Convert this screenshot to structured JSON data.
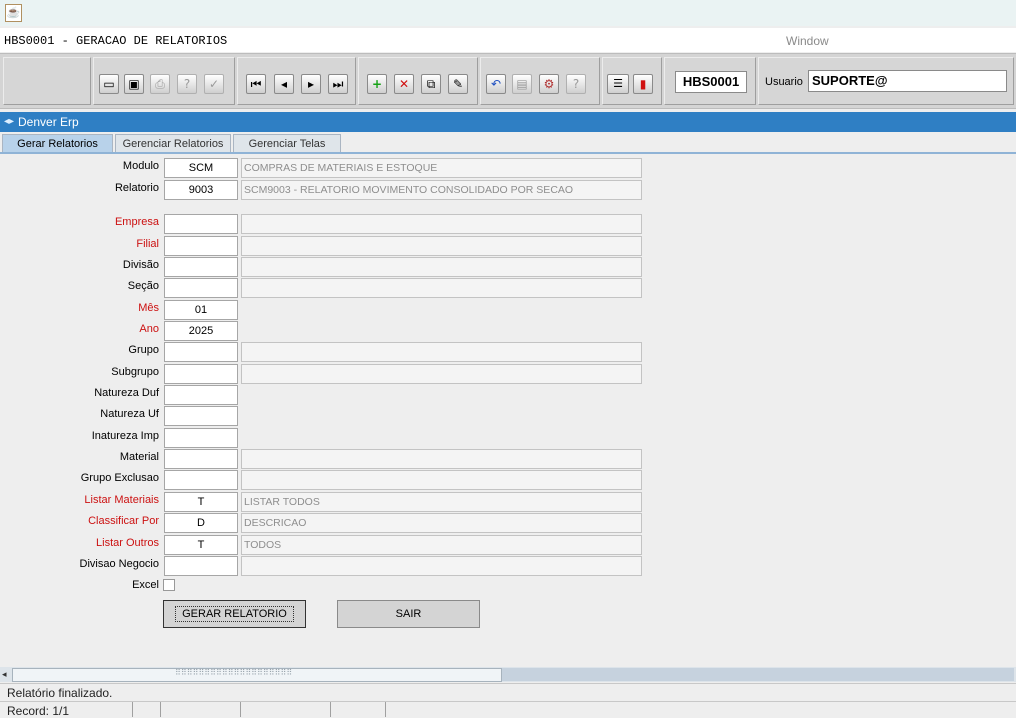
{
  "window": {
    "title": "HBS0001 - GERACAO DE RELATORIOS",
    "menu": "Window"
  },
  "toolbar": {
    "form_code": "HBS0001",
    "user_label": "Usuario",
    "user_value": "SUPORTE@",
    "buttons": [
      {
        "icon": "save-icon",
        "glyph": "▭"
      },
      {
        "icon": "window-icon",
        "glyph": "▣"
      },
      {
        "icon": "print-icon",
        "glyph": "⎙"
      },
      {
        "icon": "query-help-icon",
        "glyph": "?"
      },
      {
        "icon": "execute-query-icon",
        "glyph": "✓"
      },
      {
        "icon": "first-record-icon",
        "glyph": "⏮"
      },
      {
        "icon": "previous-record-icon",
        "glyph": "◂"
      },
      {
        "icon": "next-record-icon",
        "glyph": "▸"
      },
      {
        "icon": "last-record-icon",
        "glyph": "⏭"
      },
      {
        "icon": "insert-record-icon",
        "glyph": "+"
      },
      {
        "icon": "delete-record-icon",
        "glyph": "✕"
      },
      {
        "icon": "duplicate-record-icon",
        "glyph": "⧉"
      },
      {
        "icon": "edit-icon",
        "glyph": "✎"
      },
      {
        "icon": "undo-icon",
        "glyph": "↶"
      },
      {
        "icon": "clipboard-icon",
        "glyph": "📋"
      },
      {
        "icon": "tools-icon",
        "glyph": "⚙"
      },
      {
        "icon": "help-icon",
        "glyph": "?"
      },
      {
        "icon": "menu-icon",
        "glyph": "☰"
      },
      {
        "icon": "exit-door-icon",
        "glyph": "▮"
      }
    ]
  },
  "app": {
    "title": "Denver Erp",
    "tabs": [
      "Gerar Relatorios",
      "Gerenciar Relatorios",
      "Gerenciar Telas"
    ]
  },
  "form": {
    "fields": [
      {
        "label": "Modulo",
        "required": false,
        "code": "SCM",
        "desc": "COMPRAS DE MATERIAIS E ESTOQUE",
        "has_desc": true
      },
      {
        "label": "Relatorio",
        "required": false,
        "code": "9003",
        "desc": "SCM9003 - RELATORIO MOVIMENTO CONSOLIDADO POR SECAO",
        "has_desc": true
      },
      {
        "label": "Empresa",
        "required": true,
        "code": "",
        "desc": "",
        "has_desc": true
      },
      {
        "label": "Filial",
        "required": true,
        "code": "",
        "desc": "",
        "has_desc": true
      },
      {
        "label": "Divisão",
        "required": false,
        "code": "",
        "desc": "",
        "has_desc": true
      },
      {
        "label": "Seção",
        "required": false,
        "code": "",
        "desc": "",
        "has_desc": true
      },
      {
        "label": "Mês",
        "required": true,
        "code": "01",
        "desc": "",
        "has_desc": false
      },
      {
        "label": "Ano",
        "required": true,
        "code": "2025",
        "desc": "",
        "has_desc": false
      },
      {
        "label": "Grupo",
        "required": false,
        "code": "",
        "desc": "",
        "has_desc": true
      },
      {
        "label": "Subgrupo",
        "required": false,
        "code": "",
        "desc": "",
        "has_desc": true
      },
      {
        "label": "Natureza Duf",
        "required": false,
        "code": "",
        "desc": "",
        "has_desc": false
      },
      {
        "label": "Natureza Uf",
        "required": false,
        "code": "",
        "desc": "",
        "has_desc": false
      },
      {
        "label": "Inatureza Imp",
        "required": false,
        "code": "",
        "desc": "",
        "has_desc": false
      },
      {
        "label": "Material",
        "required": false,
        "code": "",
        "desc": "",
        "has_desc": true
      },
      {
        "label": "Grupo Exclusao",
        "required": false,
        "code": "",
        "desc": "",
        "has_desc": true
      },
      {
        "label": "Listar Materiais",
        "required": true,
        "code": "T",
        "desc": "LISTAR TODOS",
        "has_desc": true
      },
      {
        "label": "Classificar Por",
        "required": true,
        "code": "D",
        "desc": "DESCRICAO",
        "has_desc": true
      },
      {
        "label": "Listar Outros",
        "required": true,
        "code": "T",
        "desc": "TODOS",
        "has_desc": true
      },
      {
        "label": "Divisao Negocio",
        "required": false,
        "code": "",
        "desc": "",
        "has_desc": true
      }
    ],
    "excel_label": "Excel",
    "excel_checked": false,
    "generate_label": "GERAR RELATORIO",
    "exit_label": "SAIR"
  },
  "status": {
    "message": "Relatório finalizado.",
    "record": "Record: 1/1"
  },
  "colors": {
    "accent": "#2f7fc4",
    "required_label": "#cc1111"
  }
}
